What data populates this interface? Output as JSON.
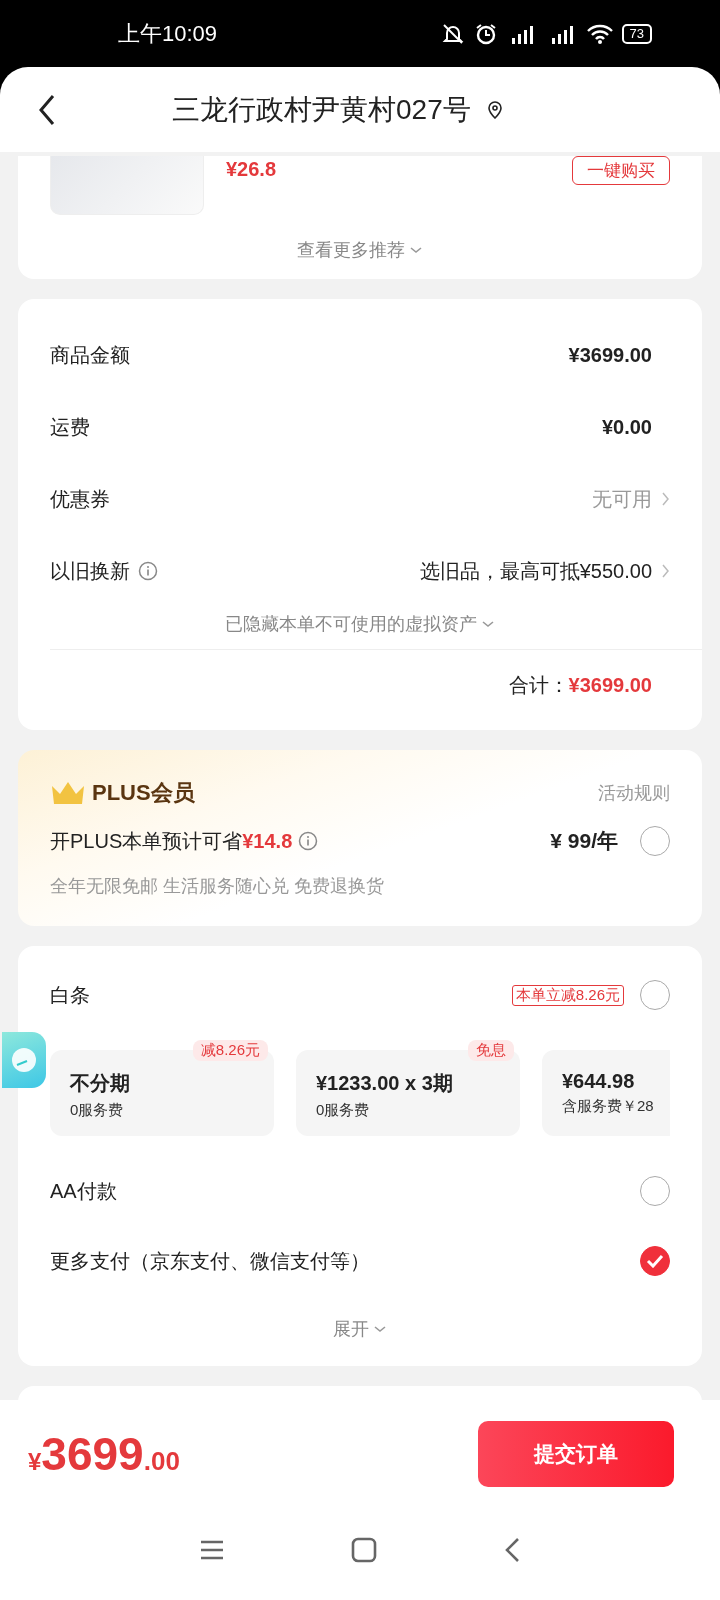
{
  "status_bar": {
    "time": "上午10:09",
    "battery": "73"
  },
  "header": {
    "title": "三龙行政村尹黄村027号"
  },
  "recommend": {
    "price": "¥26.8",
    "buy_button": "一键购买",
    "more": "查看更多推荐"
  },
  "summary": {
    "rows": [
      {
        "kind": "value",
        "label": "商品金额",
        "value": "¥3699.00"
      },
      {
        "kind": "value",
        "label": "运费",
        "value": "¥0.00"
      },
      {
        "kind": "muted_link",
        "label": "优惠券",
        "value": "无可用"
      },
      {
        "kind": "link",
        "label": "以旧换新",
        "info": true,
        "value": "选旧品，最高可抵¥550.00"
      }
    ],
    "hidden_note": "已隐藏本单不可使用的虚拟资产",
    "total_label": "合计：",
    "total": "¥3699.00"
  },
  "plus": {
    "title": "PLUS会员",
    "rules": "活动规则",
    "offer": "开PLUS本单预计可省",
    "saving": "¥14.8",
    "price": "¥ 99/年",
    "selected": false,
    "perks": "全年无限免邮 生活服务随心兑 免费退换货"
  },
  "payment": {
    "options": [
      {
        "kind": "installment",
        "label": "白条",
        "badge": "本单立减8.26元",
        "selected": false,
        "plans": [
          {
            "title": "不分期",
            "fee": "0服务费",
            "tag": "减8.26元"
          },
          {
            "title": "¥1233.00 x 3期",
            "fee": "0服务费",
            "tag": "免息"
          },
          {
            "title": "¥644.98",
            "fee": "含服务费￥28"
          }
        ]
      },
      {
        "kind": "plain",
        "label": "AA付款",
        "selected": false
      },
      {
        "kind": "plain",
        "label": "更多支付（京东支付、微信支付等）",
        "selected": true
      }
    ],
    "expand": "展开"
  },
  "footer": {
    "currency": "¥",
    "price_main": "3699",
    "price_decimal": ".00",
    "submit": "提交订单"
  }
}
